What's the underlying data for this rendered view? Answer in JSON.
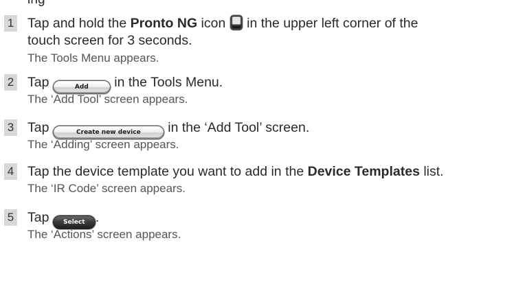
{
  "top_partial": "ing",
  "steps": [
    {
      "num": "1",
      "pre": "Tap and hold the ",
      "bold": "Pronto NG",
      "mid": " icon",
      "icon": "pronto-ng-device-icon",
      "post": " in the upper left corner of the",
      "line2": "touch screen for 3 seconds.",
      "result": "The Tools Menu appears."
    },
    {
      "num": "2",
      "pre": "Tap ",
      "button": "Add",
      "post": " in the Tools Menu.",
      "result": "The ‘Add Tool’ screen appears."
    },
    {
      "num": "3",
      "pre": "Tap ",
      "button": "Create new device",
      "post": " in the ‘Add Tool’ screen.",
      "result": "The ‘Adding’ screen appears."
    },
    {
      "num": "4",
      "pre": "Tap the device template you want to add in the ",
      "bold": "Device Templates",
      "post": " list.",
      "result": "The ‘IR Code’ screen appears."
    },
    {
      "num": "5",
      "pre": "Tap ",
      "button": "Select",
      "post": ".",
      "result": "The ‘Actions’ screen appears."
    }
  ]
}
